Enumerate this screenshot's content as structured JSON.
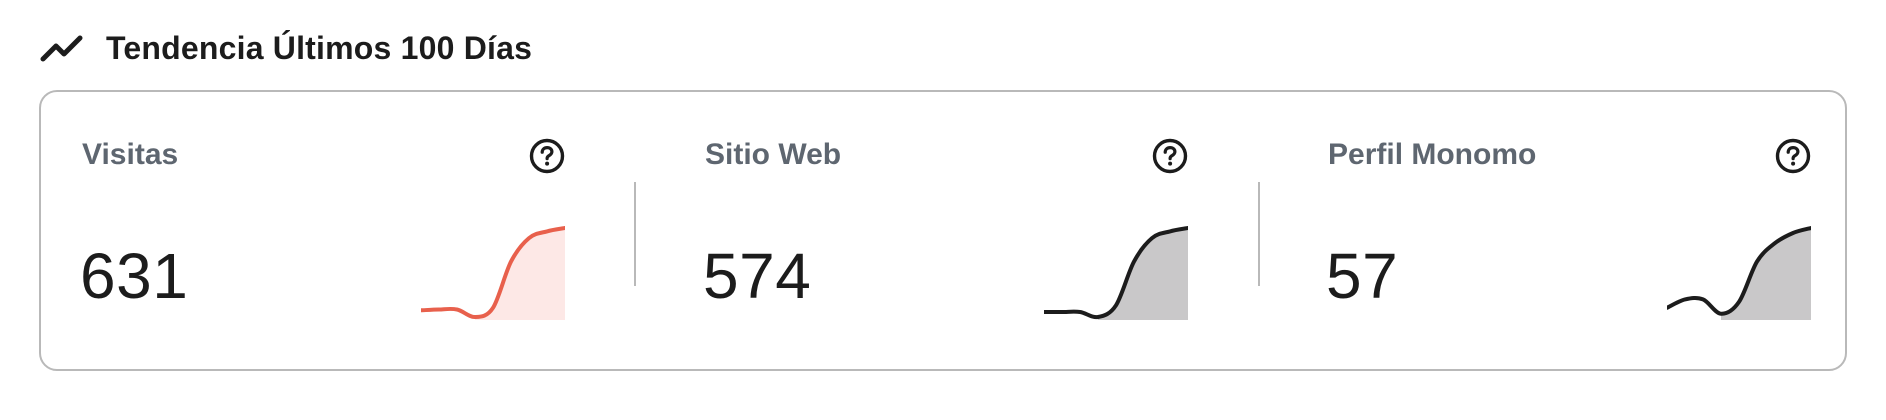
{
  "header": {
    "title": "Tendencia Últimos 100 Días",
    "icon": "trending-up-icon"
  },
  "metrics": [
    {
      "label": "Visitas",
      "value": "631",
      "help_icon": "question-circle-icon",
      "line_color": "#e8604c",
      "fill_color": "#fde8e6",
      "trend": [
        0.02,
        0.03,
        0.03,
        -0.06,
        0.05,
        0.6,
        0.88,
        0.96,
        1.0
      ]
    },
    {
      "label": "Sitio Web",
      "value": "574",
      "help_icon": "question-circle-icon",
      "line_color": "#1c1c1c",
      "fill_color": "#c9c8c9",
      "trend": [
        0.0,
        0.0,
        0.0,
        -0.06,
        0.08,
        0.6,
        0.88,
        0.96,
        1.0
      ]
    },
    {
      "label": "Perfil Monomo",
      "value": "57",
      "help_icon": "question-circle-icon",
      "line_color": "#1c1c1c",
      "fill_color": "#c9c8c9",
      "trend": [
        0.05,
        0.15,
        0.15,
        -0.02,
        0.12,
        0.6,
        0.82,
        0.94,
        1.0
      ]
    }
  ]
}
